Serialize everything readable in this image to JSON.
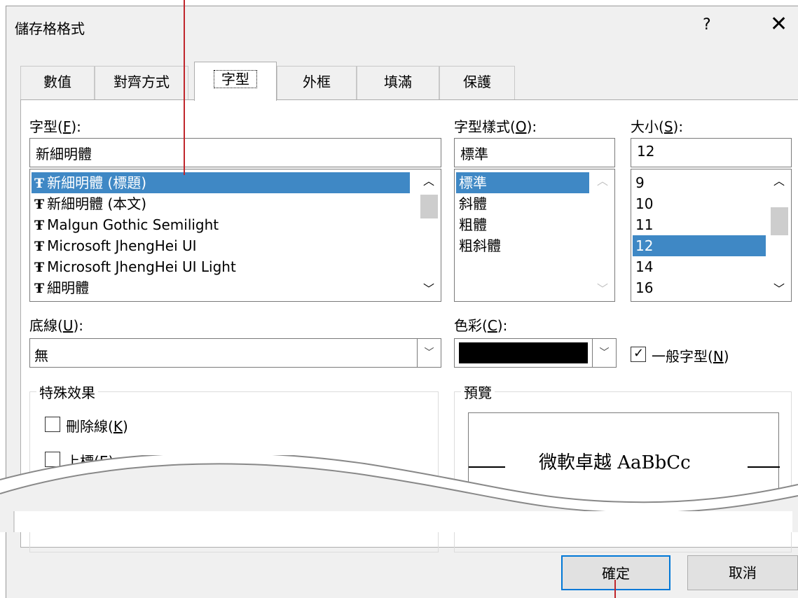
{
  "dialog": {
    "title": "儲存格格式",
    "help": "?",
    "close": "✕"
  },
  "tabs": [
    "數值",
    "對齊方式",
    "字型",
    "外框",
    "填滿",
    "保護"
  ],
  "font": {
    "label": "字型(",
    "label_key": "F",
    "label_end": "):",
    "value": "新細明體",
    "items": [
      "新細明體 (標題)",
      "新細明體 (本文)",
      "Malgun Gothic Semilight",
      "Microsoft JhengHei UI",
      "Microsoft JhengHei UI Light",
      "細明體"
    ],
    "selected_index": 0
  },
  "font_style": {
    "label": "字型樣式(",
    "label_key": "O",
    "label_end": "):",
    "value": "標準",
    "items": [
      "標準",
      "斜體",
      "粗體",
      "粗斜體"
    ]
  },
  "size": {
    "label": "大小(",
    "label_key": "S",
    "label_end": "):",
    "value": "12",
    "items": [
      "9",
      "10",
      "11",
      "12",
      "14",
      "16"
    ]
  },
  "underline": {
    "label": "底線(",
    "label_key": "U",
    "label_end": "):",
    "value": "無"
  },
  "color": {
    "label": "色彩(",
    "label_key": "C",
    "label_end": "):",
    "swatch": "#000000",
    "normal_font": "一般字型(",
    "normal_font_key": "N",
    "normal_font_end": ")",
    "normal_font_checked": true
  },
  "effects": {
    "title": "特殊效果",
    "strikethrough": "刪除線(",
    "strikethrough_key": "K",
    "superscript": "上標(",
    "superscript_key": "E",
    "close_paren": ")"
  },
  "preview": {
    "title": "預覽",
    "text": "微軟卓越 AaBbCc"
  },
  "buttons": {
    "ok": "確定",
    "cancel": "取消"
  },
  "icons": {
    "font_item": "truetype-font-icon",
    "up": "chevron-up-icon",
    "down": "chevron-down-icon"
  }
}
